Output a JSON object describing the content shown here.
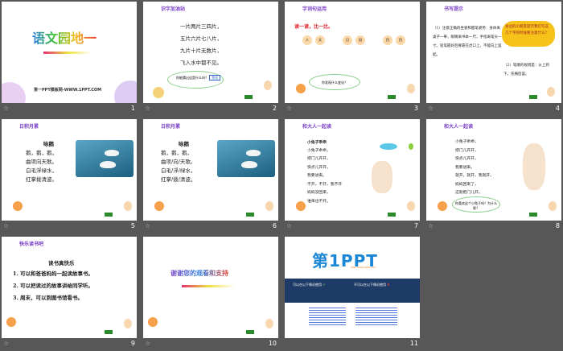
{
  "slides": [
    {
      "num": "1",
      "title": "语文园地一",
      "footer": "第一PPT模板网-WWW.1PPT.COM"
    },
    {
      "num": "2",
      "heading": "识字加油站",
      "lines": [
        "一片两片三四片，",
        "五片六片七八片，",
        "九片十片无数片，",
        "飞入水中都不见。"
      ],
      "bubble": "你能猜出这是什么吗？",
      "answer": "雪花"
    },
    {
      "num": "3",
      "heading": "字词句运用",
      "prompt": "读一读，比一比。",
      "pairs": [
        [
          "人",
          "天"
        ],
        [
          "日",
          "田"
        ],
        [
          "目",
          "目"
        ]
      ],
      "bubble": "你发现什么变化？"
    },
    {
      "num": "4",
      "heading": "书写提示",
      "p1": "（1）注意正确的坐姿和握笔姿势：身体离桌子一拳，眼睛离书本一尺，手指离笔尖一寸，铅笔握好后要靠在虎口上，不能向上竖起。",
      "bubble": "身边的小朋友提示我们写这几个字的时候要注意什么？",
      "p2": "（2）笔顺的规则是：从上到下，先横后竖。"
    },
    {
      "num": "5",
      "heading": "日积月累",
      "poem_title": "咏鹅",
      "lines": [
        "鹅，鹅，鹅，",
        "曲项向天歌。",
        "白毛浮绿水，",
        "红掌拨清波。"
      ]
    },
    {
      "num": "6",
      "heading": "日积月累",
      "poem_title": "咏鹅",
      "lines": [
        "鹅，鹅，鹅，",
        "曲项/向/天歌。",
        "白毛/浮/绿水，",
        "红掌/拨/清波。"
      ]
    },
    {
      "num": "7",
      "heading": "和大人一起读",
      "poem_title": "小兔子乖乖",
      "lines": [
        "小兔子乖乖，",
        "把门儿开开，",
        "快点儿开开，",
        "我要进来。",
        "不开，不开，我不开",
        "妈妈没回来，",
        "谁来也不开。"
      ]
    },
    {
      "num": "8",
      "heading": "和大人一起读",
      "lines": [
        "小兔子乖乖，",
        "把门儿开开，",
        "快点儿开开，",
        "我要进来。",
        "就开，就开，我就开，",
        "妈妈回来了，",
        "这就把门儿开。"
      ],
      "bubble": "你喜欢这个小兔子吗？为什么呢？"
    },
    {
      "num": "9",
      "heading": "快乐读书吧",
      "poem_title": "读书真快乐",
      "lines": [
        "1. 可以和爸爸妈妈一起读故事书。",
        "2. 可以把读过的故事讲给同学听。",
        "3. 周末，可以到图书馆看书。"
      ]
    },
    {
      "num": "10",
      "title": "谢谢您的观看和支持"
    },
    {
      "num": "11",
      "logo": "第1PPT",
      "logo_url": "http://www.1ppt.com",
      "can": "可以在以下情况使用",
      "cannot": "不可以在以下情况使用"
    }
  ],
  "colors": {
    "background": "#575757",
    "accent_red": "#e0202a",
    "heading_purple": "#7a3fc8",
    "banner": "#1d3b66"
  }
}
